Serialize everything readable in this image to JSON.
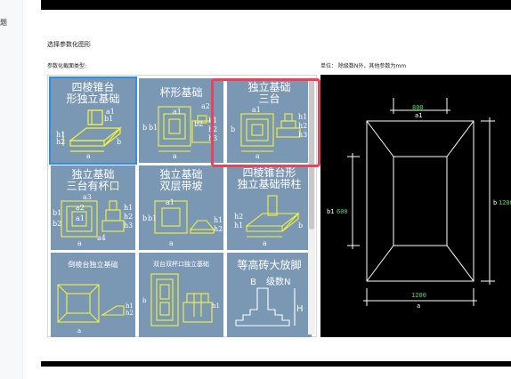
{
  "left_panel": {
    "edge_text": "题"
  },
  "dialog": {
    "title": "选择参数化图形",
    "section_label": "参数化截面类型:",
    "unit_label": "单位： 除级数N外，其他参数为mm"
  },
  "thumbnails": [
    {
      "id": "t1",
      "line1": "四棱锥台",
      "line2": "形独立基础",
      "selected": true,
      "labels": [
        "a1",
        "b1",
        "h1",
        "h2",
        "b",
        "a"
      ]
    },
    {
      "id": "t2",
      "line1": "杯形基础",
      "line2": "",
      "selected": false,
      "labels": [
        "a2",
        "a1",
        "b",
        "b1",
        "b2",
        "b3",
        "h1",
        "h2",
        "h3",
        "a"
      ]
    },
    {
      "id": "t3",
      "line1": "独立基础",
      "line2": "三台",
      "selected": false,
      "labels": [
        "a1",
        "b",
        "h1",
        "h2",
        "h3",
        "a"
      ]
    },
    {
      "id": "t4",
      "line1": "独立基础",
      "line2": "三台有杯口",
      "selected": false,
      "labels": [
        "a3",
        "a2",
        "a1",
        "a4",
        "h1",
        "h2",
        "h3",
        "b1",
        "b2",
        "a"
      ]
    },
    {
      "id": "t5",
      "line1": "独立基础",
      "line2": "双层带坡",
      "selected": false,
      "labels": [
        "a1",
        "b",
        "b1",
        "h1",
        "h2",
        "a"
      ]
    },
    {
      "id": "t6",
      "line1": "四棱锥台形",
      "line2": "独立基础带柱",
      "selected": false,
      "labels": [
        "h2",
        "h1",
        "b",
        "a"
      ]
    },
    {
      "id": "t7",
      "line1": "倒棱台独立基础",
      "line2": "",
      "selected": false,
      "small": true,
      "labels": [
        "h1",
        "h2",
        "a"
      ]
    },
    {
      "id": "t8",
      "line1": "双台双杯口独立基础",
      "line2": "",
      "selected": false,
      "small": true,
      "labels": [
        "b",
        "h1"
      ]
    },
    {
      "id": "t9",
      "line1": "等高砖大放脚",
      "line2": "",
      "selected": false,
      "labels": [
        "B",
        "级数N",
        "H"
      ]
    }
  ],
  "preview": {
    "top_dim": "800",
    "top_dim_label": "a1",
    "left_dim": "600",
    "left_dim_label": "b1",
    "right_dim": "1200",
    "right_dim_label": "b",
    "bottom_dim": "1200",
    "bottom_dim_label": "a",
    "colors": {
      "dim_text": "#2ee84a",
      "lines": "#ffffff"
    }
  },
  "colors": {
    "thumb_bg": "#7a98b4",
    "drawing": "#f4f43a",
    "selected_outline": "#2e8fe8",
    "highlight": "#e8435a"
  }
}
